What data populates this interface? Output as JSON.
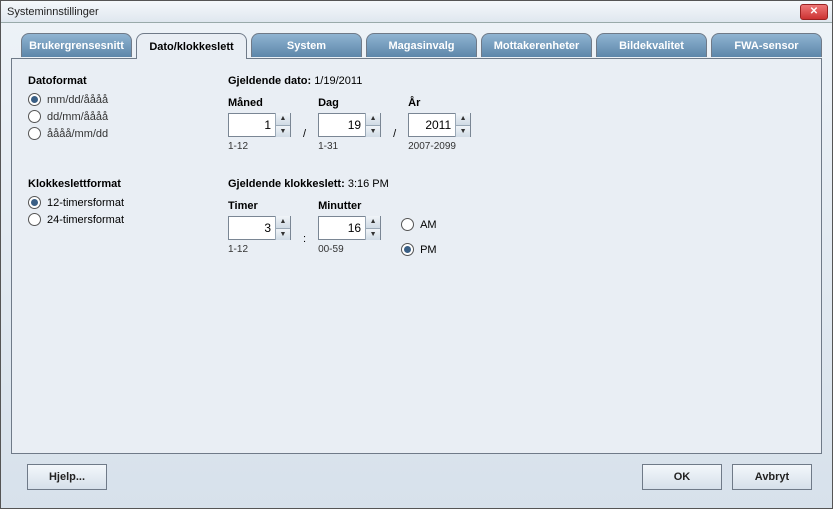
{
  "window": {
    "title": "Systeminnstillinger"
  },
  "tabs": {
    "items": [
      {
        "label": "Brukergrensesnitt"
      },
      {
        "label": "Dato/klokkeslett"
      },
      {
        "label": "System"
      },
      {
        "label": "Magasinvalg"
      },
      {
        "label": "Mottakerenheter"
      },
      {
        "label": "Bildekvalitet"
      },
      {
        "label": "FWA-sensor"
      }
    ],
    "activeIndex": 1
  },
  "dateFormat": {
    "heading": "Datoformat",
    "options": [
      {
        "label": "mm/dd/åååå",
        "selected": true
      },
      {
        "label": "dd/mm/åååå",
        "selected": false
      },
      {
        "label": "åååå/mm/dd",
        "selected": false
      }
    ]
  },
  "currentDate": {
    "label": "Gjeldende dato:",
    "value": "1/19/2011",
    "month": {
      "label": "Måned",
      "value": "1",
      "hint": "1-12"
    },
    "day": {
      "label": "Dag",
      "value": "19",
      "hint": "1-31"
    },
    "year": {
      "label": "År",
      "value": "2011",
      "hint": "2007-2099"
    },
    "sep": "/"
  },
  "timeFormat": {
    "heading": "Klokkeslettformat",
    "options": [
      {
        "label": "12-timersformat",
        "selected": true
      },
      {
        "label": "24-timersformat",
        "selected": false
      }
    ]
  },
  "currentTime": {
    "label": "Gjeldende klokkeslett:",
    "value": "3:16 PM",
    "hours": {
      "label": "Timer",
      "value": "3",
      "hint": "1-12"
    },
    "minutes": {
      "label": "Minutter",
      "value": "16",
      "hint": "00-59"
    },
    "sep": ":",
    "ampm": {
      "am": {
        "label": "AM",
        "selected": false
      },
      "pm": {
        "label": "PM",
        "selected": true
      }
    }
  },
  "buttons": {
    "help": "Hjelp...",
    "ok": "OK",
    "cancel": "Avbryt"
  }
}
